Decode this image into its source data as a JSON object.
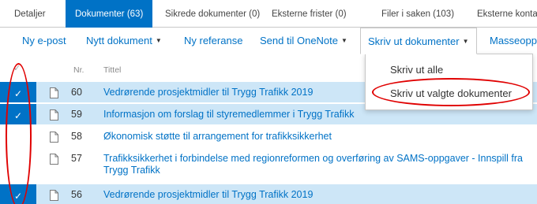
{
  "tabs": [
    {
      "label": "Detaljer",
      "active": false
    },
    {
      "label": "Dokumenter (63)",
      "active": true
    },
    {
      "label": "Sikrede dokumenter (0)",
      "active": false
    },
    {
      "label": "Eksterne frister (0)",
      "active": false
    },
    {
      "label": "Filer i saken (103)",
      "active": false
    },
    {
      "label": "Eksterne konta",
      "active": false
    }
  ],
  "commands": {
    "new_email": "Ny e-post",
    "new_document": "Nytt dokument",
    "new_reference": "Ny referanse",
    "send_onenote": "Send til OneNote",
    "print_documents": "Skriv ut dokumenter",
    "mass": "Masseoppd"
  },
  "print_menu": {
    "items": [
      "Skriv ut alle",
      "Skriv ut valgte dokumenter"
    ]
  },
  "list": {
    "header": {
      "nr": "Nr.",
      "title": "Tittel"
    },
    "rows": [
      {
        "nr": "60",
        "title": "Vedrørende prosjektmidler til Trygg Trafikk 2019",
        "selected": true
      },
      {
        "nr": "59",
        "title": "Informasjon om forslag til styremedlemmer i Trygg Trafikk",
        "selected": true
      },
      {
        "nr": "58",
        "title": "Økonomisk støtte til arrangement for trafikksikkerhet",
        "selected": false
      },
      {
        "nr": "57",
        "title": "Trafikksikkerhet i forbindelse med regionreformen og overføring av SAMS-oppgaver - Innspill fra Trygg Trafikk",
        "selected": false
      },
      {
        "nr": "56",
        "title": "Vedrørende prosjektmidler til Trygg Trafikk 2019",
        "selected": true
      }
    ]
  },
  "colors": {
    "accent": "#0072c6",
    "selected_row": "#cde6f7",
    "annotation": "#e00000"
  },
  "icons": {
    "document": "document-icon",
    "checkmark": "checkmark-icon",
    "caret": "caret-down-icon"
  }
}
